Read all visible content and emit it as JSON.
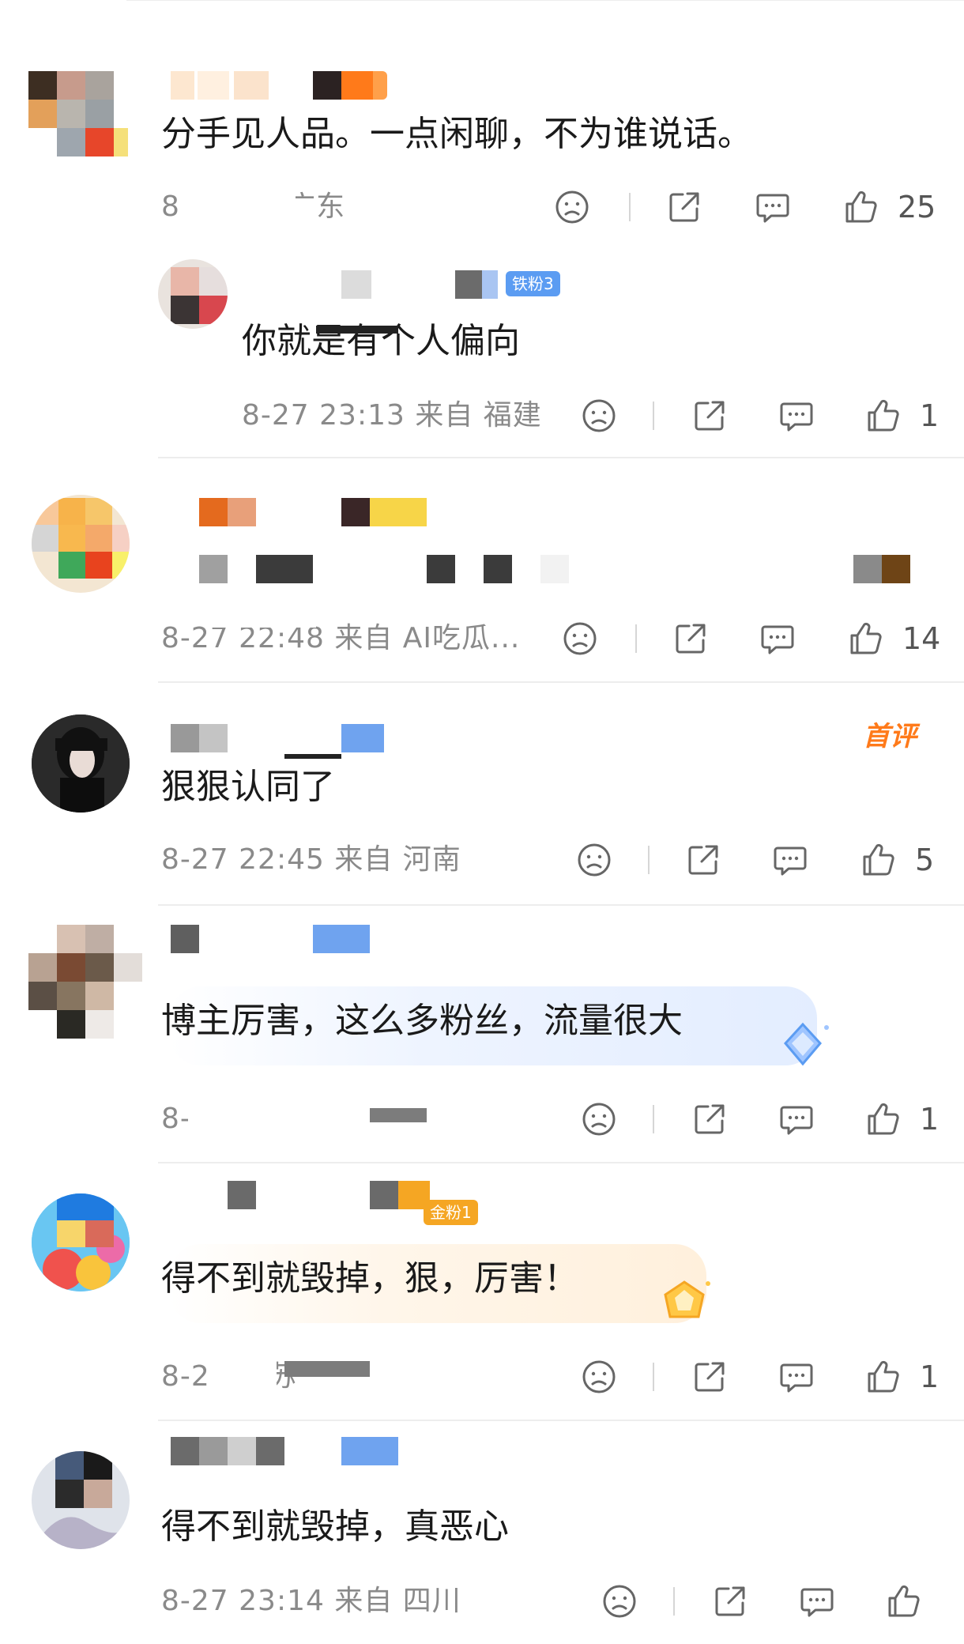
{
  "comments": [
    {
      "text": "分手见人品。一点闲聊，不为谁说话。",
      "meta": "8 0 来自 广东",
      "likes": "25"
    },
    {
      "text": "你就是有个人偏向",
      "meta": "8-27 23:13 来自 福建",
      "likes": "1",
      "badge": "铁粉3"
    },
    {
      "text": "",
      "meta": "8-27 22:48 来自 AI吃瓜...",
      "likes": "14"
    },
    {
      "text": "狠狠认同了",
      "meta": "8-27 22:45 来自 河南",
      "likes": "5",
      "tag": "首评"
    },
    {
      "text": "博主厉害，这么多粉丝，流量很大",
      "meta": "8-2 贵州",
      "likes": "1"
    },
    {
      "text": "得不到就毁掉，狠，厉害！",
      "meta": "8-27 江苏",
      "likes": "1",
      "badge": "金粉1"
    },
    {
      "text": "得不到就毁掉，真恶心",
      "meta": "8-27 23:14 来自 四川",
      "likes": ""
    }
  ],
  "icons": [
    "dislike-icon",
    "share-icon",
    "comment-icon",
    "like-icon"
  ],
  "colors": {
    "accent": "#ff7a1a",
    "fan_badge": "#5b9cf2",
    "gold_badge": "#f5a623"
  }
}
